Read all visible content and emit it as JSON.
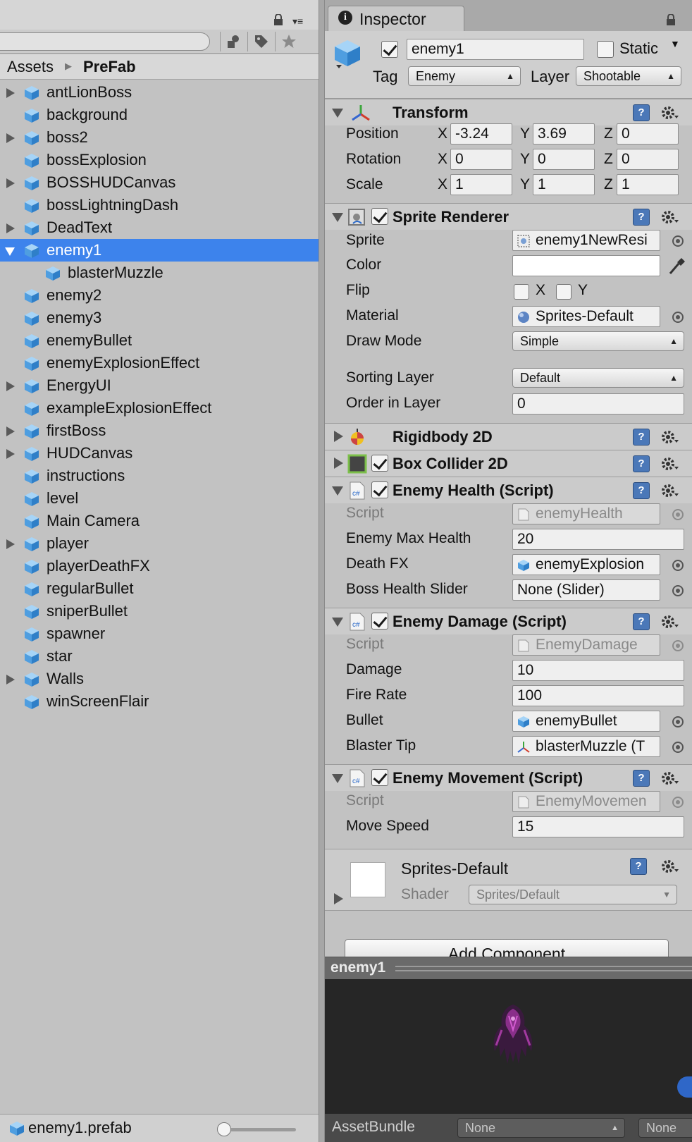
{
  "project": {
    "breadcrumb": {
      "root": "Assets",
      "current": "PreFab"
    },
    "items": [
      {
        "label": "antLionBoss",
        "expandable": true
      },
      {
        "label": "background",
        "expandable": false
      },
      {
        "label": "boss2",
        "expandable": true
      },
      {
        "label": "bossExplosion",
        "expandable": false
      },
      {
        "label": "BOSSHUDCanvas",
        "expandable": true
      },
      {
        "label": "bossLightningDash",
        "expandable": false
      },
      {
        "label": "DeadText",
        "expandable": true
      },
      {
        "label": "enemy1",
        "expandable": true,
        "selected": true,
        "expanded": true
      },
      {
        "label": "blasterMuzzle",
        "expandable": false,
        "child": true
      },
      {
        "label": "enemy2",
        "expandable": false
      },
      {
        "label": "enemy3",
        "expandable": false
      },
      {
        "label": "enemyBullet",
        "expandable": false
      },
      {
        "label": "enemyExplosionEffect",
        "expandable": false
      },
      {
        "label": "EnergyUI",
        "expandable": true
      },
      {
        "label": "exampleExplosionEffect",
        "expandable": false
      },
      {
        "label": "firstBoss",
        "expandable": true
      },
      {
        "label": "HUDCanvas",
        "expandable": true
      },
      {
        "label": "instructions",
        "expandable": false
      },
      {
        "label": "level",
        "expandable": false
      },
      {
        "label": "Main Camera",
        "expandable": false
      },
      {
        "label": "player",
        "expandable": true
      },
      {
        "label": "playerDeathFX",
        "expandable": false
      },
      {
        "label": "regularBullet",
        "expandable": false
      },
      {
        "label": "sniperBullet",
        "expandable": false
      },
      {
        "label": "spawner",
        "expandable": false
      },
      {
        "label": "star",
        "expandable": false
      },
      {
        "label": "Walls",
        "expandable": true
      },
      {
        "label": "winScreenFlair",
        "expandable": false
      }
    ],
    "footer": {
      "selected_file": "enemy1.prefab"
    }
  },
  "inspector": {
    "tab_title": "Inspector",
    "header": {
      "name": "enemy1",
      "active": true,
      "static_label": "Static",
      "tag_label": "Tag",
      "tag_value": "Enemy",
      "layer_label": "Layer",
      "layer_value": "Shootable"
    },
    "transform": {
      "title": "Transform",
      "position_label": "Position",
      "rotation_label": "Rotation",
      "scale_label": "Scale",
      "axis_x": "X",
      "axis_y": "Y",
      "axis_z": "Z",
      "position": [
        "-3.24",
        "3.69",
        "0"
      ],
      "rotation": [
        "0",
        "0",
        "0"
      ],
      "scale": [
        "1",
        "1",
        "1"
      ]
    },
    "sprite_renderer": {
      "title": "Sprite Renderer",
      "sprite_label": "Sprite",
      "sprite_value": "enemy1NewResi",
      "color_label": "Color",
      "color_value": "#ffffff",
      "flip_label": "Flip",
      "flip_x": "X",
      "flip_y": "Y",
      "material_label": "Material",
      "material_value": "Sprites-Default",
      "draw_mode_label": "Draw Mode",
      "draw_mode_value": "Simple",
      "sorting_layer_label": "Sorting Layer",
      "sorting_layer_value": "Default",
      "order_label": "Order in Layer",
      "order_value": "0"
    },
    "rigidbody": {
      "title": "Rigidbody 2D"
    },
    "box_collider": {
      "title": "Box Collider 2D"
    },
    "enemy_health": {
      "title": "Enemy Health (Script)",
      "script_label": "Script",
      "script_value": "enemyHealth",
      "max_health_label": "Enemy Max Health",
      "max_health_value": "20",
      "death_fx_label": "Death FX",
      "death_fx_value": "enemyExplosion",
      "slider_label": "Boss Health Slider",
      "slider_value": "None (Slider)"
    },
    "enemy_damage": {
      "title": "Enemy Damage (Script)",
      "script_label": "Script",
      "script_value": "EnemyDamage",
      "damage_label": "Damage",
      "damage_value": "10",
      "fire_rate_label": "Fire Rate",
      "fire_rate_value": "100",
      "bullet_label": "Bullet",
      "bullet_value": "enemyBullet",
      "tip_label": "Blaster Tip",
      "tip_value": "blasterMuzzle (T"
    },
    "enemy_movement": {
      "title": "Enemy Movement (Script)",
      "script_label": "Script",
      "script_value": "EnemyMovemen",
      "speed_label": "Move Speed",
      "speed_value": "15"
    },
    "material": {
      "name": "Sprites-Default",
      "shader_label": "Shader",
      "shader_value": "Sprites/Default"
    },
    "add_component": "Add Component",
    "preview_title": "enemy1",
    "assetbundle": {
      "label": "AssetBundle",
      "value": "None",
      "variant": "None"
    }
  },
  "colors": {
    "selection": "#3d83ec",
    "cube": "#5aa7e6",
    "help": "#4b78b8"
  }
}
